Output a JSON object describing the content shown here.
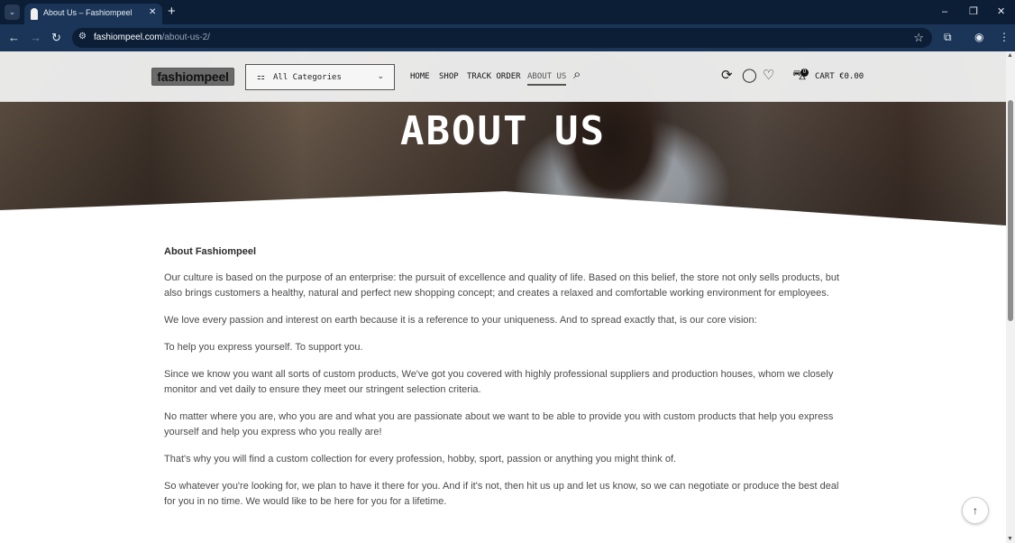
{
  "browser": {
    "tab_search_icon": "chevron-down-icon",
    "tab_title": "About Us – Fashiompeel",
    "tab_close": "✕",
    "new_tab": "+",
    "window_buttons": {
      "minimize": "–",
      "restore": "❐",
      "close": "✕"
    },
    "nav": {
      "back": "←",
      "forward": "→",
      "reload": "↻"
    },
    "url_host": "fashiompeel.com",
    "url_path": "/about-us-2/",
    "site_info_icon": "⚙",
    "star": "☆",
    "extensions_icon": "⧉",
    "profile_icon": "◉",
    "menu_icon": "⋮"
  },
  "header": {
    "logo_text": "fashiompeel",
    "category_icon": "⚏",
    "category_label": "All Categories",
    "category_chevron": "⌄",
    "menu": [
      {
        "label": "HOME"
      },
      {
        "label": "SHOP"
      },
      {
        "label": "TRACK ORDER"
      },
      {
        "label": "ABOUT US"
      }
    ],
    "search_icon": "⌕",
    "sync_icon": "⟳",
    "account_icon": "◯",
    "wishlist_icon": "♡",
    "cart_icon": "⛍",
    "cart_count": "0",
    "cart_label": "CART €0.00"
  },
  "hero": {
    "title": "ABOUT US"
  },
  "content": {
    "heading": "About Fashiompeel",
    "paragraphs": [
      "Our culture is based on the purpose of an enterprise: the pursuit of excellence and quality of life. Based on this belief, the store not only sells products, but also brings customers a healthy, natural and perfect new shopping concept; and creates a relaxed and comfortable working environment for employees.",
      "We love every passion and interest on earth because it is a reference to your uniqueness. And to spread exactly that, is our core vision:",
      "To help you express yourself. To support you.",
      "Since we know you want all sorts of custom products, We've got you covered with highly professional suppliers and production houses, whom we closely monitor and vet daily to ensure they meet our stringent selection criteria.",
      "No matter where you are, who you are and what you are passionate about we want to be able to provide you with custom products that help you express yourself and help you express who you really are!",
      "That's why you will find a custom collection for every profession, hobby, sport, passion or anything you might think of.",
      "So whatever you're looking for, we plan to have it there for you. And if it's not, then hit us up and let us know, so we can negotiate or produce the best deal for you in no time. We would like to be here for you for a lifetime."
    ]
  },
  "back_to_top_icon": "↑",
  "scrollbar": {
    "up": "▲",
    "down": "▼"
  }
}
